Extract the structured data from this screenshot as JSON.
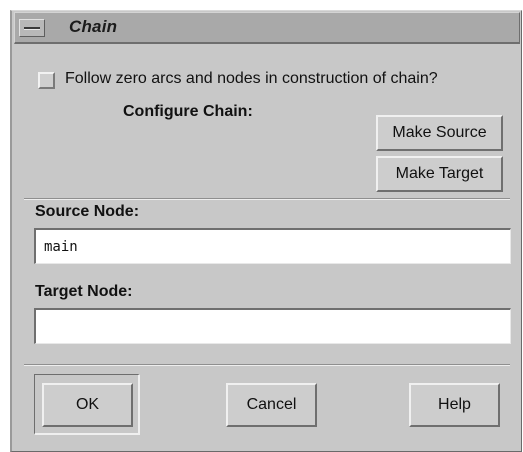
{
  "window": {
    "title": "Chain",
    "menu_icon": "window-menu-icon"
  },
  "options": {
    "follow_zero_label": "Follow zero arcs and nodes in construction of chain?",
    "follow_zero_checked": false
  },
  "configure": {
    "label": "Configure Chain:",
    "make_source_label": "Make Source",
    "make_target_label": "Make Target"
  },
  "source": {
    "label": "Source Node:",
    "value": "main"
  },
  "target": {
    "label": "Target Node:",
    "value": ""
  },
  "actions": {
    "ok_label": "OK",
    "cancel_label": "Cancel",
    "help_label": "Help"
  },
  "colors": {
    "dialog_background": "#c8c8c8",
    "titlebar_background": "#a9a9a9",
    "field_background": "#ffffff"
  }
}
